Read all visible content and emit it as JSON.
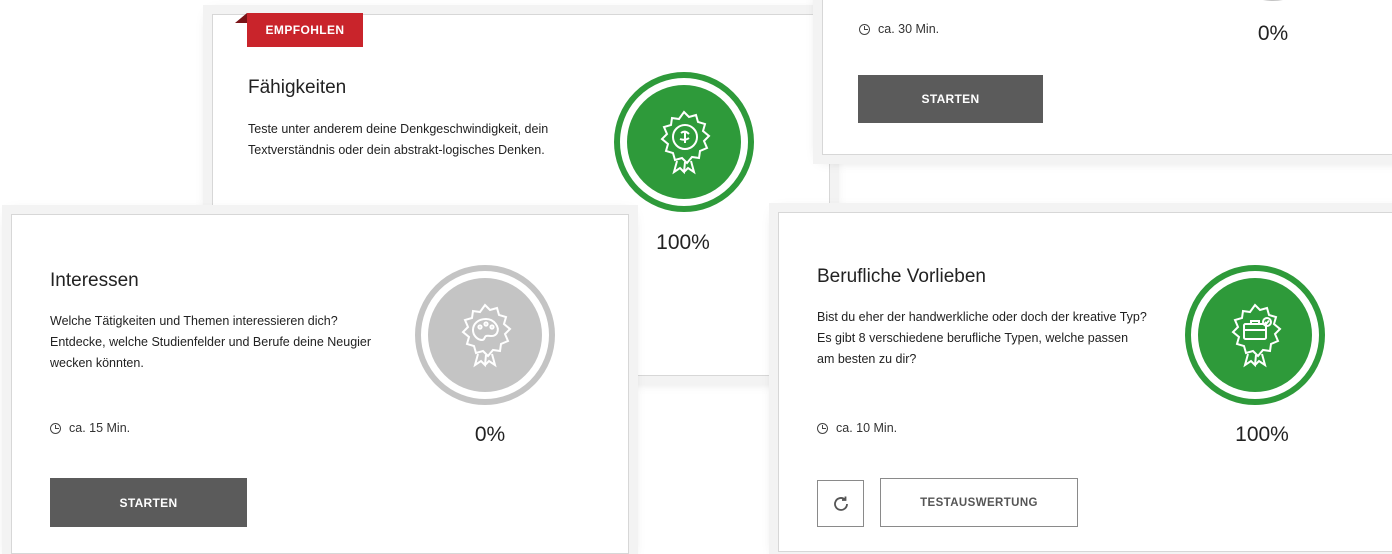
{
  "colors": {
    "accent_red": "#c9242b",
    "complete_green": "#2e9a3a",
    "pending_gray": "#c4c4c4",
    "button_dark": "#5b5b5b"
  },
  "cards": {
    "faehigkeiten": {
      "badge": "EMPFOHLEN",
      "title": "Fähigkeiten",
      "description": "Teste unter anderem deine Denkgeschwindigkeit, dein Textverständnis oder dein abstrakt-logisches Denken.",
      "progress": "100%",
      "progress_value": 1.0,
      "icon": "brain-badge-icon"
    },
    "top_right": {
      "time": "ca. 30 Min.",
      "progress": "0%",
      "progress_value": 0.0,
      "button": "STARTEN"
    },
    "interessen": {
      "title": "Interessen",
      "description": "Welche Tätigkeiten und Themen interessieren dich? Entdecke, welche Studienfelder und Berufe deine Neugier wecken könnten.",
      "time": "ca. 15 Min.",
      "progress": "0%",
      "progress_value": 0.0,
      "button": "STARTEN",
      "icon": "palette-badge-icon"
    },
    "berufliche": {
      "title": "Berufliche Vorlieben",
      "description": "Bist du eher der handwerkliche oder doch der kreative Typ? Es gibt 8 verschiedene berufliche Typen, welche passen am besten zu dir?",
      "time": "ca. 10 Min.",
      "progress": "100%",
      "progress_value": 1.0,
      "button": "TESTAUSWERTUNG",
      "icon": "briefcase-badge-icon"
    }
  }
}
